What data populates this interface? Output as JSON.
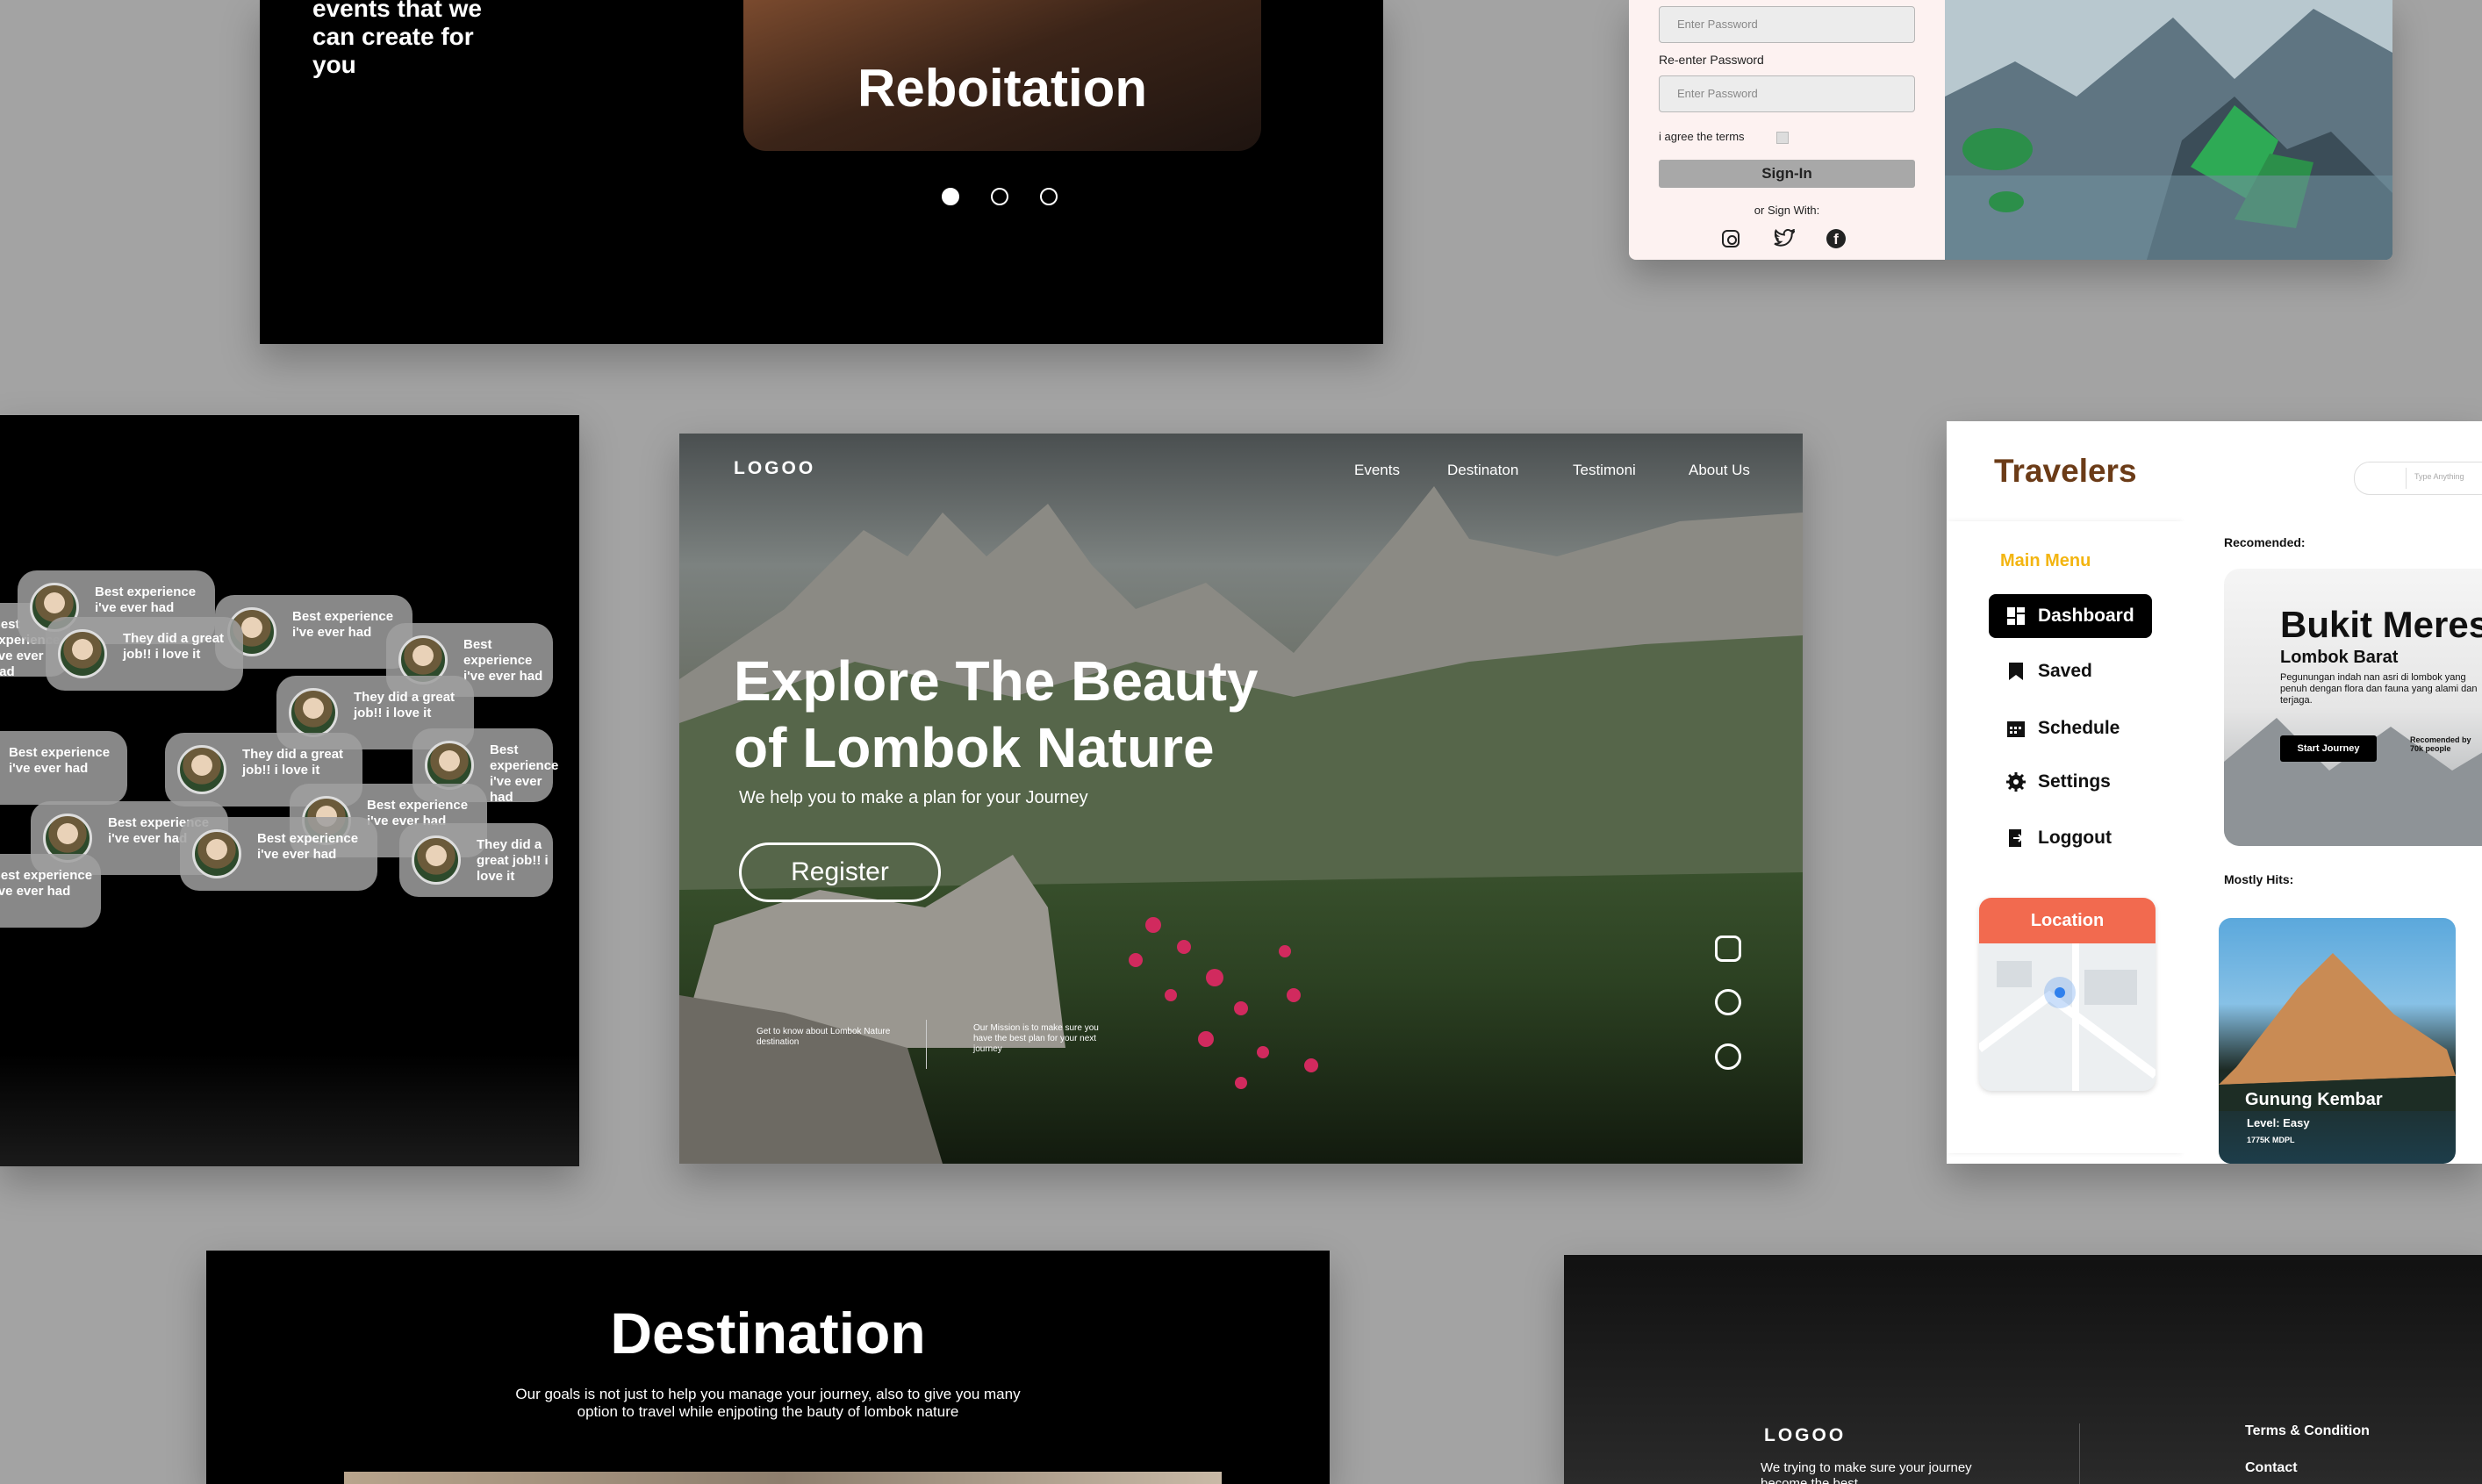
{
  "events_panel": {
    "tagline": "events that we can create for you",
    "slide_title": "Reboitation",
    "carousel_dots": 3,
    "active_dot": 1
  },
  "signin_panel": {
    "password_placeholder": "Enter Password",
    "reenter_label": "Re-enter Password",
    "reenter_placeholder": "Enter Password",
    "terms_label": "i agree the terms",
    "signin_button": "Sign-In",
    "or_sign_with": "or Sign With:",
    "social": [
      "instagram-icon",
      "twitter-icon",
      "facebook-icon"
    ]
  },
  "testimonials_panel": {
    "bubbles": [
      "Best experience i've ever had",
      "Best experience i've ever had",
      "They did a great job!! i love it",
      "Best experience i've ever had",
      "They did a great job!! i love it",
      "Best experience i've ever had",
      "They did a great job!! i love it",
      "Best experience i've ever had",
      "Best experience i've ever had",
      "Best experience i've ever had",
      "Best experience i've ever had"
    ]
  },
  "hero": {
    "logo": "LOGOO",
    "nav": [
      "Events",
      "Destinaton",
      "Testimoni",
      "About Us"
    ],
    "headline_line1": "Explore The Beauty",
    "headline_line2": "of Lombok Nature",
    "subhead": "We help you to make a plan for your Journey",
    "register_button": "Register",
    "footer_left": "Get to know about Lombok Nature destination",
    "footer_right": "Our Mission is to make sure you have the best plan for your next journey"
  },
  "dashboard": {
    "brand": "Travelers",
    "search_placeholder": "Type Anything",
    "main_menu_label": "Main Menu",
    "menu": [
      "Dashboard",
      "Saved",
      "Schedule",
      "Settings",
      "Loggout"
    ],
    "active_menu": "Dashboard",
    "location_label": "Location",
    "recommended_label": "Recomended:",
    "featured_title": "Bukit Meres",
    "featured_subtitle": "Lombok Barat",
    "featured_desc": "Pegunungan indah nan asri di lombok yang penuh dengan flora dan fauna yang alami dan terjaga.",
    "start_journey": "Start Journey",
    "recommended_by": "Recomended by 70k people",
    "mostly_hits_label": "Mostly Hits:",
    "hit_title": "Gunung Kembar",
    "hit_level": "Level: Easy",
    "hit_elevation": "1775K MDPL",
    "accent_color": "#f3b511",
    "location_color": "#f26a4f"
  },
  "destination_panel": {
    "title": "Destination",
    "desc_line1": "Our goals is not just to help you manage your journey, also to give you many",
    "desc_line2": "option to travel while enjpoting the bauty of lombok nature"
  },
  "footer_panel": {
    "logo": "LOGOO",
    "tagline": "We trying to make sure your journey become the best",
    "terms": "Terms & Condition",
    "contact": "Contact"
  }
}
